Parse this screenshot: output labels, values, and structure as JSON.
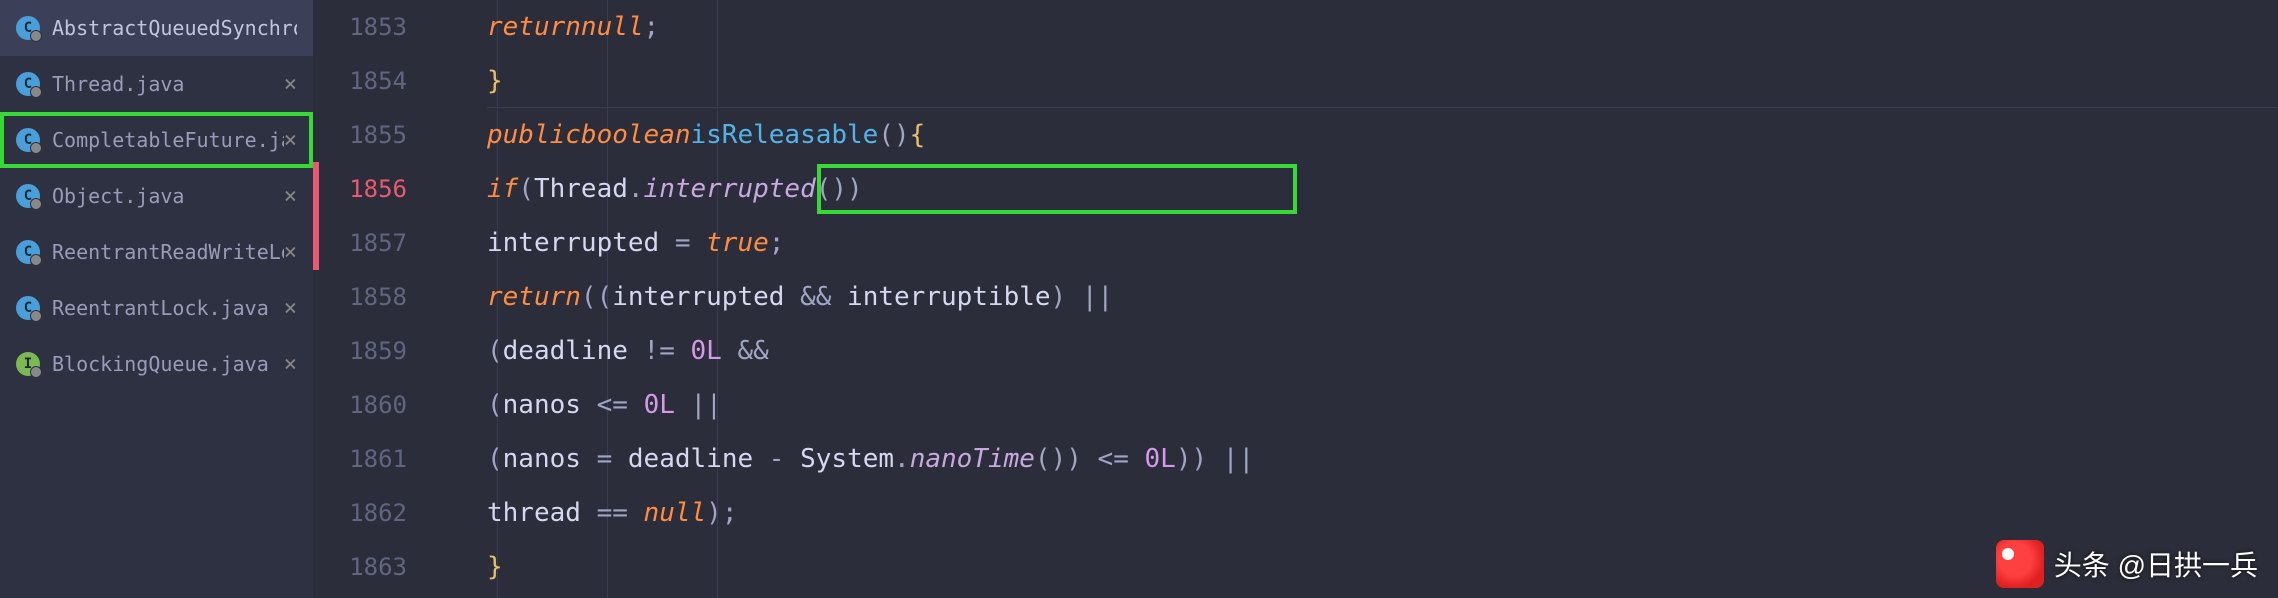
{
  "tabs": [
    {
      "label": "AbstractQueuedSynchronizer.java",
      "iconLetter": "C",
      "iconType": "blue",
      "active": true,
      "closeable": false,
      "highlighted": false
    },
    {
      "label": "Thread.java",
      "iconLetter": "C",
      "iconType": "blue",
      "active": false,
      "closeable": true,
      "highlighted": false
    },
    {
      "label": "CompletableFuture.java",
      "iconLetter": "C",
      "iconType": "blue",
      "active": false,
      "closeable": true,
      "highlighted": true
    },
    {
      "label": "Object.java",
      "iconLetter": "C",
      "iconType": "blue",
      "active": false,
      "closeable": true,
      "highlighted": false
    },
    {
      "label": "ReentrantReadWriteLock.java",
      "iconLetter": "C",
      "iconType": "blue",
      "active": false,
      "closeable": true,
      "highlighted": false
    },
    {
      "label": "ReentrantLock.java",
      "iconLetter": "C",
      "iconType": "blue",
      "active": false,
      "closeable": true,
      "highlighted": false
    },
    {
      "label": "BlockingQueue.java",
      "iconLetter": "I",
      "iconType": "green",
      "active": false,
      "closeable": true,
      "highlighted": false
    }
  ],
  "lineNumbers": [
    "1853",
    "1854",
    "1855",
    "1856",
    "1857",
    "1858",
    "1859",
    "1860",
    "1861",
    "1862",
    "1863"
  ],
  "currentLine": "1856",
  "markerLine": "1855",
  "code": {
    "kw_return": "return",
    "kw_public": "public",
    "kw_boolean": "boolean",
    "kw_if": "if",
    "kw_null": "null",
    "kw_true": "true",
    "m_isReleasable": "isReleasable",
    "cls_Thread": "Thread",
    "m_interrupted": "interrupted",
    "id_interrupted": "interrupted",
    "id_interruptible": "interruptible",
    "id_deadline": "deadline",
    "id_nanos": "nanos",
    "id_thread": "thread",
    "cls_System": "System",
    "m_nanoTime": "nanoTime",
    "num_0L": "0L",
    "op_eq": " = ",
    "op_eqeq": " == ",
    "op_neq": " != ",
    "op_lte": " <= ",
    "op_and": " && ",
    "op_or": " || ",
    "op_minus": " - "
  },
  "watermark": {
    "prefix": "头条",
    "text": "@日拱一兵"
  }
}
